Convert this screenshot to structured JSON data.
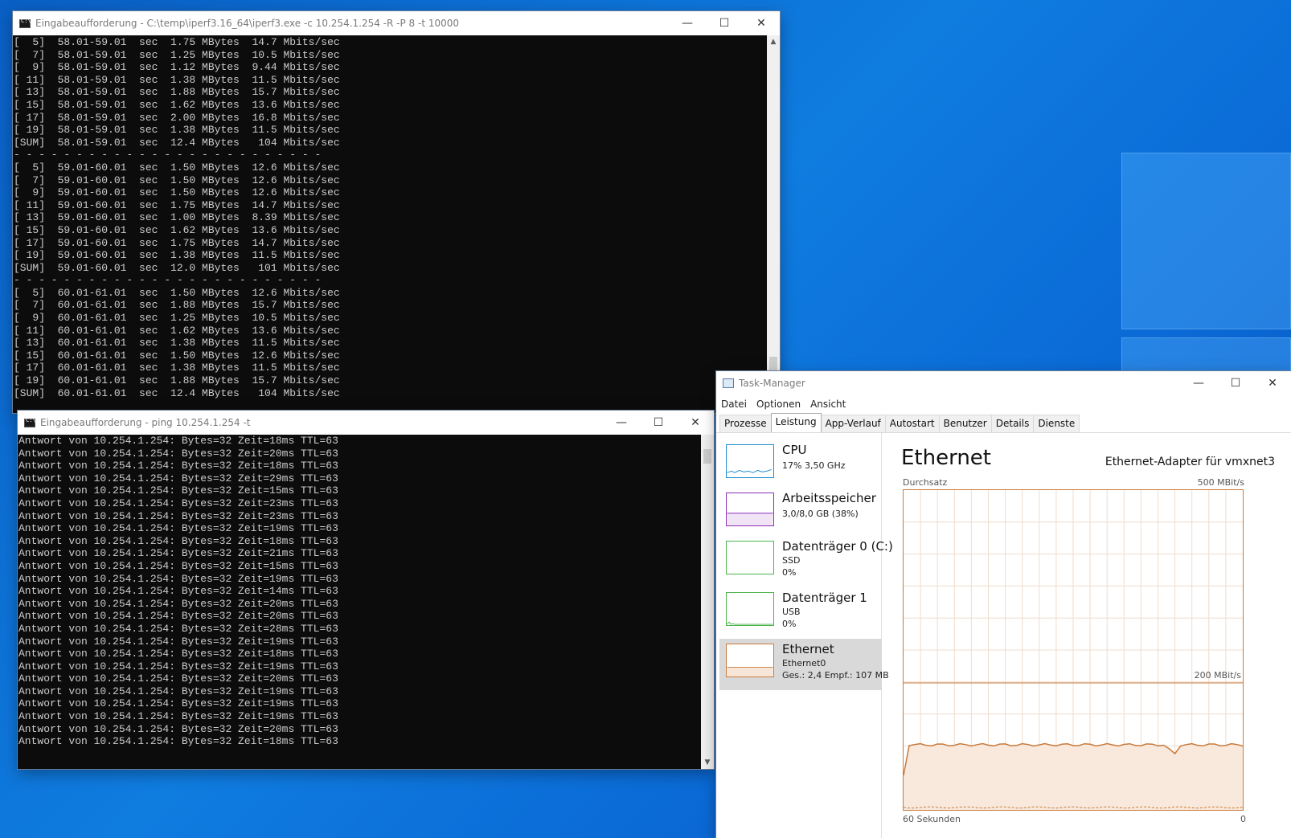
{
  "iperf_window": {
    "title": "Eingabeaufforderung - C:\\temp\\iperf3.16_64\\iperf3.exe  -c 10.254.1.254 -R -P 8 -t 10000",
    "lines": [
      "[  5]  58.01-59.01  sec  1.75 MBytes  14.7 Mbits/sec",
      "[  7]  58.01-59.01  sec  1.25 MBytes  10.5 Mbits/sec",
      "[  9]  58.01-59.01  sec  1.12 MBytes  9.44 Mbits/sec",
      "[ 11]  58.01-59.01  sec  1.38 MBytes  11.5 Mbits/sec",
      "[ 13]  58.01-59.01  sec  1.88 MBytes  15.7 Mbits/sec",
      "[ 15]  58.01-59.01  sec  1.62 MBytes  13.6 Mbits/sec",
      "[ 17]  58.01-59.01  sec  2.00 MBytes  16.8 Mbits/sec",
      "[ 19]  58.01-59.01  sec  1.38 MBytes  11.5 Mbits/sec",
      "[SUM]  58.01-59.01  sec  12.4 MBytes   104 Mbits/sec",
      "- - - - - - - - - - - - - - - - - - - - - - - - -",
      "[  5]  59.01-60.01  sec  1.50 MBytes  12.6 Mbits/sec",
      "[  7]  59.01-60.01  sec  1.50 MBytes  12.6 Mbits/sec",
      "[  9]  59.01-60.01  sec  1.50 MBytes  12.6 Mbits/sec",
      "[ 11]  59.01-60.01  sec  1.75 MBytes  14.7 Mbits/sec",
      "[ 13]  59.01-60.01  sec  1.00 MBytes  8.39 Mbits/sec",
      "[ 15]  59.01-60.01  sec  1.62 MBytes  13.6 Mbits/sec",
      "[ 17]  59.01-60.01  sec  1.75 MBytes  14.7 Mbits/sec",
      "[ 19]  59.01-60.01  sec  1.38 MBytes  11.5 Mbits/sec",
      "[SUM]  59.01-60.01  sec  12.0 MBytes   101 Mbits/sec",
      "- - - - - - - - - - - - - - - - - - - - - - - - -",
      "[  5]  60.01-61.01  sec  1.50 MBytes  12.6 Mbits/sec",
      "[  7]  60.01-61.01  sec  1.88 MBytes  15.7 Mbits/sec",
      "[  9]  60.01-61.01  sec  1.25 MBytes  10.5 Mbits/sec",
      "[ 11]  60.01-61.01  sec  1.62 MBytes  13.6 Mbits/sec",
      "[ 13]  60.01-61.01  sec  1.38 MBytes  11.5 Mbits/sec",
      "[ 15]  60.01-61.01  sec  1.50 MBytes  12.6 Mbits/sec",
      "[ 17]  60.01-61.01  sec  1.38 MBytes  11.5 Mbits/sec",
      "[ 19]  60.01-61.01  sec  1.88 MBytes  15.7 Mbits/sec",
      "[SUM]  60.01-61.01  sec  12.4 MBytes   104 Mbits/sec"
    ]
  },
  "ping_window": {
    "title": "Eingabeaufforderung - ping  10.254.1.254 -t",
    "lines": [
      "Antwort von 10.254.1.254: Bytes=32 Zeit=18ms TTL=63",
      "Antwort von 10.254.1.254: Bytes=32 Zeit=20ms TTL=63",
      "Antwort von 10.254.1.254: Bytes=32 Zeit=18ms TTL=63",
      "Antwort von 10.254.1.254: Bytes=32 Zeit=29ms TTL=63",
      "Antwort von 10.254.1.254: Bytes=32 Zeit=15ms TTL=63",
      "Antwort von 10.254.1.254: Bytes=32 Zeit=23ms TTL=63",
      "Antwort von 10.254.1.254: Bytes=32 Zeit=23ms TTL=63",
      "Antwort von 10.254.1.254: Bytes=32 Zeit=19ms TTL=63",
      "Antwort von 10.254.1.254: Bytes=32 Zeit=18ms TTL=63",
      "Antwort von 10.254.1.254: Bytes=32 Zeit=21ms TTL=63",
      "Antwort von 10.254.1.254: Bytes=32 Zeit=15ms TTL=63",
      "Antwort von 10.254.1.254: Bytes=32 Zeit=19ms TTL=63",
      "Antwort von 10.254.1.254: Bytes=32 Zeit=14ms TTL=63",
      "Antwort von 10.254.1.254: Bytes=32 Zeit=20ms TTL=63",
      "Antwort von 10.254.1.254: Bytes=32 Zeit=20ms TTL=63",
      "Antwort von 10.254.1.254: Bytes=32 Zeit=28ms TTL=63",
      "Antwort von 10.254.1.254: Bytes=32 Zeit=19ms TTL=63",
      "Antwort von 10.254.1.254: Bytes=32 Zeit=18ms TTL=63",
      "Antwort von 10.254.1.254: Bytes=32 Zeit=19ms TTL=63",
      "Antwort von 10.254.1.254: Bytes=32 Zeit=20ms TTL=63",
      "Antwort von 10.254.1.254: Bytes=32 Zeit=19ms TTL=63",
      "Antwort von 10.254.1.254: Bytes=32 Zeit=19ms TTL=63",
      "Antwort von 10.254.1.254: Bytes=32 Zeit=19ms TTL=63",
      "Antwort von 10.254.1.254: Bytes=32 Zeit=20ms TTL=63",
      "Antwort von 10.254.1.254: Bytes=32 Zeit=18ms TTL=63"
    ]
  },
  "task_manager": {
    "title": "Task-Manager",
    "menu": [
      "Datei",
      "Optionen",
      "Ansicht"
    ],
    "tabs": [
      "Prozesse",
      "Leistung",
      "App-Verlauf",
      "Autostart",
      "Benutzer",
      "Details",
      "Dienste"
    ],
    "active_tab": "Leistung",
    "sidebar": [
      {
        "name": "CPU",
        "sub1": "17% 3,50 GHz",
        "sub2": "",
        "color": "#1e8bd2"
      },
      {
        "name": "Arbeitsspeicher",
        "sub1": "3,0/8,0 GB (38%)",
        "sub2": "",
        "color": "#8b2fb8"
      },
      {
        "name": "Datenträger 0 (C:)",
        "sub1": "SSD",
        "sub2": "0%",
        "color": "#4db34d"
      },
      {
        "name": "Datenträger 1",
        "sub1": "USB",
        "sub2": "0%",
        "color": "#4db34d"
      },
      {
        "name": "Ethernet",
        "sub1": "Ethernet0",
        "sub2": "Ges.: 2,4 Empf.: 107 MB",
        "color": "#c87a3c"
      }
    ],
    "panel": {
      "title": "Ethernet",
      "adapter": "Ethernet-Adapter für vmxnet3",
      "throughput_label": "Durchsatz",
      "max_label": "500 MBit/s",
      "secondary_label": "200 MBit/s",
      "time_label": "60 Sekunden",
      "zero_label": "0",
      "accent": "#c87a3c"
    }
  }
}
